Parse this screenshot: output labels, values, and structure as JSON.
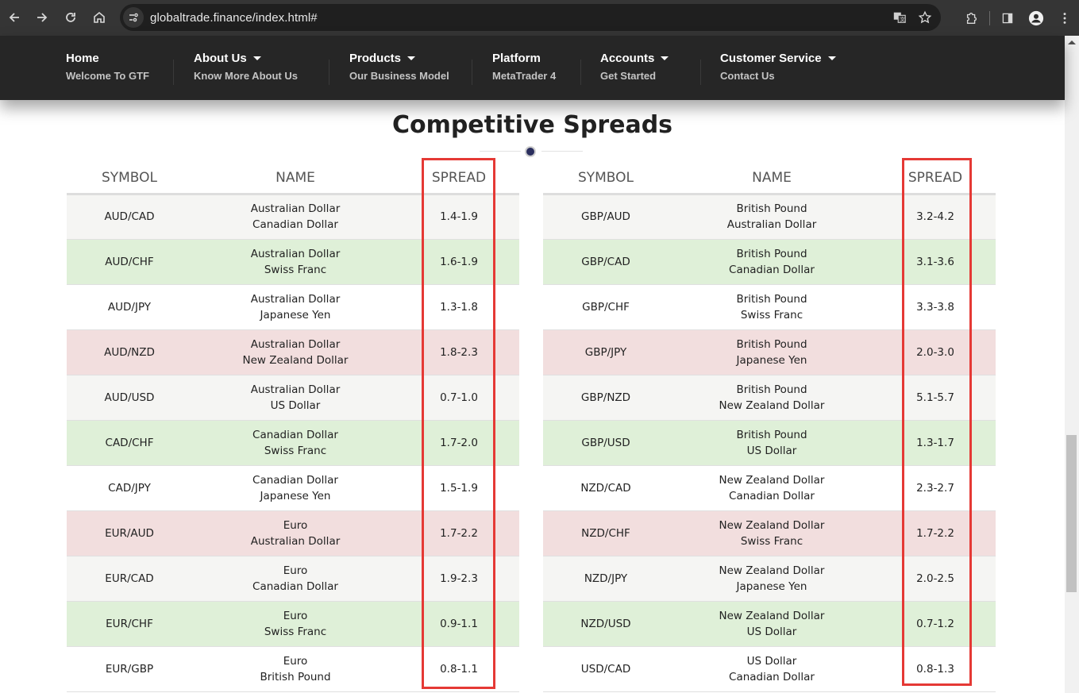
{
  "browser": {
    "url": "globaltrade.finance/index.html#",
    "icons": [
      "back-icon",
      "forward-icon",
      "reload-icon",
      "home-icon",
      "site-info-icon",
      "translate-icon",
      "bookmark-star-icon",
      "extensions-icon",
      "side-panel-icon",
      "profile-icon",
      "more-menu-icon"
    ]
  },
  "nav": {
    "items": [
      {
        "label": "Home",
        "sub": "Welcome To GTF",
        "dropdown": false
      },
      {
        "label": "About Us",
        "sub": "Know More About Us",
        "dropdown": true
      },
      {
        "label": "Products",
        "sub": "Our Business Model",
        "dropdown": true
      },
      {
        "label": "Platform",
        "sub": "MetaTrader 4",
        "dropdown": false
      },
      {
        "label": "Accounts",
        "sub": "Get Started",
        "dropdown": true
      },
      {
        "label": "Customer Service",
        "sub": "Contact Us",
        "dropdown": true
      }
    ]
  },
  "section": {
    "title": "Competitive Spreads"
  },
  "colors": {
    "highlight": "#e53935",
    "row_green": "#dff0d8",
    "row_red": "#f2dede",
    "row_grey": "#f5f5f3",
    "nav_bg": "#262626",
    "dot": "#2b2f5e"
  },
  "tables": [
    {
      "headers": {
        "symbol": "SYMBOL",
        "name": "NAME",
        "spread": "SPREAD"
      },
      "rows": [
        {
          "symbol": "AUD/CAD",
          "base": "Australian Dollar",
          "quote": "Canadian Dollar",
          "spread": "1.4-1.9",
          "style": "grey"
        },
        {
          "symbol": "AUD/CHF",
          "base": "Australian Dollar",
          "quote": "Swiss Franc",
          "spread": "1.6-1.9",
          "style": "green"
        },
        {
          "symbol": "AUD/JPY",
          "base": "Australian Dollar",
          "quote": "Japanese Yen",
          "spread": "1.3-1.8",
          "style": "white"
        },
        {
          "symbol": "AUD/NZD",
          "base": "Australian Dollar",
          "quote": "New Zealand Dollar",
          "spread": "1.8-2.3",
          "style": "red"
        },
        {
          "symbol": "AUD/USD",
          "base": "Australian Dollar",
          "quote": "US Dollar",
          "spread": "0.7-1.0",
          "style": "grey"
        },
        {
          "symbol": "CAD/CHF",
          "base": "Canadian Dollar",
          "quote": "Swiss Franc",
          "spread": "1.7-2.0",
          "style": "green"
        },
        {
          "symbol": "CAD/JPY",
          "base": "Canadian Dollar",
          "quote": "Japanese Yen",
          "spread": "1.5-1.9",
          "style": "white"
        },
        {
          "symbol": "EUR/AUD",
          "base": "Euro",
          "quote": "Australian Dollar",
          "spread": "1.7-2.2",
          "style": "red"
        },
        {
          "symbol": "EUR/CAD",
          "base": "Euro",
          "quote": "Canadian Dollar",
          "spread": "1.9-2.3",
          "style": "grey"
        },
        {
          "symbol": "EUR/CHF",
          "base": "Euro",
          "quote": "Swiss Franc",
          "spread": "0.9-1.1",
          "style": "green"
        },
        {
          "symbol": "EUR/GBP",
          "base": "Euro",
          "quote": "British Pound",
          "spread": "0.8-1.1",
          "style": "white"
        }
      ]
    },
    {
      "headers": {
        "symbol": "SYMBOL",
        "name": "NAME",
        "spread": "SPREAD"
      },
      "rows": [
        {
          "symbol": "GBP/AUD",
          "base": "British Pound",
          "quote": "Australian Dollar",
          "spread": "3.2-4.2",
          "style": "grey"
        },
        {
          "symbol": "GBP/CAD",
          "base": "British Pound",
          "quote": "Canadian Dollar",
          "spread": "3.1-3.6",
          "style": "green"
        },
        {
          "symbol": "GBP/CHF",
          "base": "British Pound",
          "quote": "Swiss Franc",
          "spread": "3.3-3.8",
          "style": "white"
        },
        {
          "symbol": "GBP/JPY",
          "base": "British Pound",
          "quote": "Japanese Yen",
          "spread": "2.0-3.0",
          "style": "red"
        },
        {
          "symbol": "GBP/NZD",
          "base": "British Pound",
          "quote": "New Zealand Dollar",
          "spread": "5.1-5.7",
          "style": "grey"
        },
        {
          "symbol": "GBP/USD",
          "base": "British Pound",
          "quote": "US Dollar",
          "spread": "1.3-1.7",
          "style": "green"
        },
        {
          "symbol": "NZD/CAD",
          "base": "New Zealand Dollar",
          "quote": "Canadian Dollar",
          "spread": "2.3-2.7",
          "style": "white"
        },
        {
          "symbol": "NZD/CHF",
          "base": "New Zealand Dollar",
          "quote": "Swiss Franc",
          "spread": "1.7-2.2",
          "style": "red"
        },
        {
          "symbol": "NZD/JPY",
          "base": "New Zealand Dollar",
          "quote": "Japanese Yen",
          "spread": "2.0-2.5",
          "style": "grey"
        },
        {
          "symbol": "NZD/USD",
          "base": "New Zealand Dollar",
          "quote": "US Dollar",
          "spread": "0.7-1.2",
          "style": "green"
        },
        {
          "symbol": "USD/CAD",
          "base": "US Dollar",
          "quote": "Canadian Dollar",
          "spread": "0.8-1.3",
          "style": "white"
        }
      ]
    }
  ]
}
